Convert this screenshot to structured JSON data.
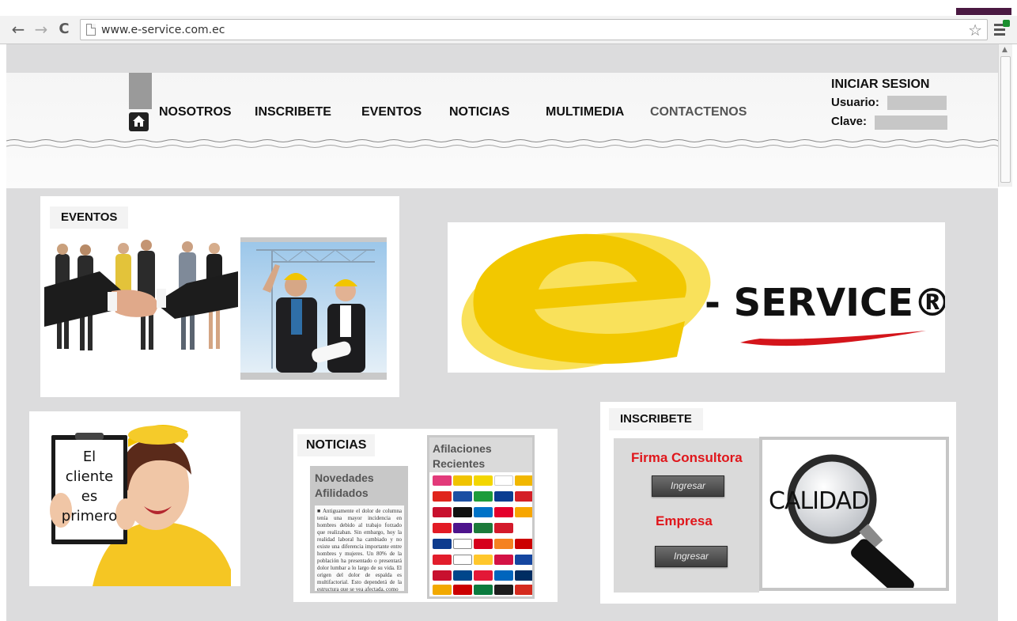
{
  "browser": {
    "url": "www.e-service.com.ec",
    "back_icon": "←",
    "forward_icon": "→",
    "reload_icon": "C",
    "star_icon": "☆"
  },
  "nav": {
    "items": [
      "NOSOTROS",
      "INSCRIBETE",
      "EVENTOS",
      "NOTICIAS",
      "MULTIMEDIA",
      "CONTACTENOS"
    ]
  },
  "login": {
    "title": "INICIAR SESION",
    "user_label": "Usuario:",
    "pass_label": "Clave:"
  },
  "eventos": {
    "title": "EVENTOS"
  },
  "logo": {
    "letter": "e",
    "text": "- SERVICE®"
  },
  "cliente": {
    "sign_text": "El cliente es primero"
  },
  "noticias": {
    "title": "NOTICIAS",
    "novedades_title": "Novedades Afilidados",
    "article_text": "■ Antiguamente el dolor de columna tenía una mayor incidencia en hombres debido al trabajo forzado que realizaban. Sin embargo, hoy la realidad laboral ha cambiado y no existe una diferencia importante entre hombres y mujeres. Un 80% de la población ha presentado o presentará dolor lumbar a lo largo de su vida. El origen del dolor de espalda es multifactorial. Esto dependerá de la estructura que se vea afectada, como",
    "afiliaciones_title": "Afilaciones Recientes"
  },
  "inscribete": {
    "title": "INSCRIBETE",
    "firma_label": "Firma Consultora",
    "empresa_label": "Empresa",
    "ingresar_label": "Ingresar",
    "calidad_text": "CALIDAD"
  },
  "colors": {
    "accent_red": "#e0161b",
    "logo_yellow": "#f2c800",
    "page_gray": "#dcdcdd"
  }
}
